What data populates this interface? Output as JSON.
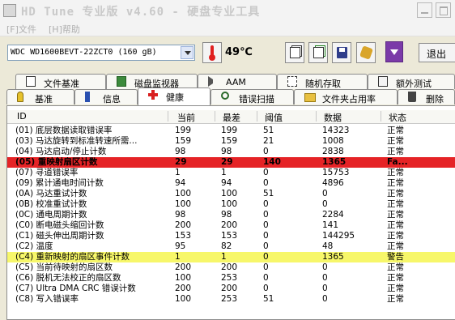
{
  "window": {
    "title": "HD Tune 专业版 v4.60 - 硬盘专业工具"
  },
  "menu": [
    {
      "label": "[F]文件"
    },
    {
      "label": "[H]帮助"
    }
  ],
  "toolbar": {
    "drive": "WDC WD1600BEVT-22ZCT0 (160 gB)",
    "temperature": "49℃",
    "exit_label": "退出"
  },
  "tabs_top": [
    {
      "label": "文件基准",
      "icon": "file-benchmark-icon"
    },
    {
      "label": "磁盘监视器",
      "icon": "disk-monitor-icon"
    },
    {
      "label": "AAM",
      "icon": "speaker-icon"
    },
    {
      "label": "随机存取",
      "icon": "random-access-icon"
    },
    {
      "label": "额外测试",
      "icon": "extra-tests-icon"
    }
  ],
  "tabs_bottom": [
    {
      "label": "基准",
      "icon": "benchmark-icon"
    },
    {
      "label": "信息",
      "icon": "info-icon"
    },
    {
      "label": "健康",
      "icon": "health-icon"
    },
    {
      "label": "错误扫描",
      "icon": "error-scan-icon"
    },
    {
      "label": "文件夹占用率",
      "icon": "folder-icon"
    },
    {
      "label": "删除",
      "icon": "trash-icon"
    }
  ],
  "columns": [
    "ID",
    "当前",
    "最差",
    "阈值",
    "数据",
    "状态"
  ],
  "rows": [
    {
      "id": "(01) 底层数据读取错误率",
      "current": "199",
      "worst": "199",
      "threshold": "51",
      "data": "14323",
      "status": "正常"
    },
    {
      "id": "(03) 马达旋转到标准转速所需...",
      "current": "159",
      "worst": "159",
      "threshold": "21",
      "data": "1008",
      "status": "正常"
    },
    {
      "id": "(04) 马达启动/停止计数",
      "current": "98",
      "worst": "98",
      "threshold": "0",
      "data": "2838",
      "status": "正常"
    },
    {
      "id": "(05) 重映射扇区计数",
      "current": "29",
      "worst": "29",
      "threshold": "140",
      "data": "1365",
      "status": "Fa...",
      "highlight": "red"
    },
    {
      "id": "(07) 寻道错误率",
      "current": "1",
      "worst": "1",
      "threshold": "0",
      "data": "15753",
      "status": "正常"
    },
    {
      "id": "(09) 累计通电时间计数",
      "current": "94",
      "worst": "94",
      "threshold": "0",
      "data": "4896",
      "status": "正常"
    },
    {
      "id": "(0A) 马达重试计数",
      "current": "100",
      "worst": "100",
      "threshold": "51",
      "data": "0",
      "status": "正常"
    },
    {
      "id": "(0B) 校准重试计数",
      "current": "100",
      "worst": "100",
      "threshold": "0",
      "data": "0",
      "status": "正常"
    },
    {
      "id": "(0C) 通电周期计数",
      "current": "98",
      "worst": "98",
      "threshold": "0",
      "data": "2284",
      "status": "正常"
    },
    {
      "id": "(C0) 断电磁头缩回计数",
      "current": "200",
      "worst": "200",
      "threshold": "0",
      "data": "141",
      "status": "正常"
    },
    {
      "id": "(C1) 磁头伸出周期计数",
      "current": "153",
      "worst": "153",
      "threshold": "0",
      "data": "144295",
      "status": "正常"
    },
    {
      "id": "(C2) 温度",
      "current": "95",
      "worst": "82",
      "threshold": "0",
      "data": "48",
      "status": "正常"
    },
    {
      "id": "(C4) 重新映射的扇区事件计数",
      "current": "1",
      "worst": "1",
      "threshold": "0",
      "data": "1365",
      "status": "警告",
      "highlight": "yellow"
    },
    {
      "id": "(C5) 当前待映射的扇区数",
      "current": "200",
      "worst": "200",
      "threshold": "0",
      "data": "0",
      "status": "正常"
    },
    {
      "id": "(C6) 脱机无法校正的扇区数",
      "current": "100",
      "worst": "253",
      "threshold": "0",
      "data": "0",
      "status": "正常"
    },
    {
      "id": "(C7) Ultra DMA CRC 错误计数",
      "current": "200",
      "worst": "200",
      "threshold": "0",
      "data": "0",
      "status": "正常"
    },
    {
      "id": "(C8) 写入错误率",
      "current": "100",
      "worst": "253",
      "threshold": "51",
      "data": "0",
      "status": "正常"
    }
  ],
  "colors": {
    "failed_row": "#e52326",
    "warning_row": "#f7f76a"
  }
}
